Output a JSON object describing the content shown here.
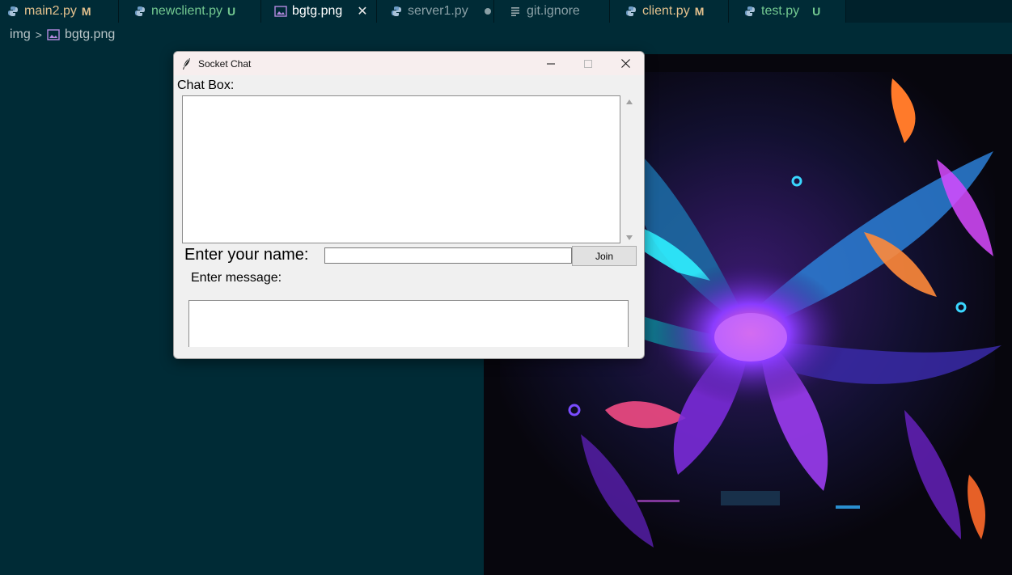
{
  "tabs": [
    {
      "name": "main2.py",
      "badge": "M",
      "icon": "python-icon",
      "color": "#e2c08d",
      "state": "modified"
    },
    {
      "name": "newclient.py",
      "badge": "U",
      "icon": "python-icon",
      "color": "#73c991",
      "state": "untracked"
    },
    {
      "name": "bgtg.png",
      "badge": "",
      "icon": "image-icon",
      "color": "#ffffff",
      "state": "active",
      "close": "✕"
    },
    {
      "name": "server1.py",
      "badge": "",
      "icon": "python-icon",
      "color": "#8aa0a6",
      "state": "unsaved"
    },
    {
      "name": "git.ignore",
      "badge": "",
      "icon": "lines-icon",
      "color": "#8aa0a6",
      "state": "normal"
    },
    {
      "name": "client.py",
      "badge": "M",
      "icon": "python-icon",
      "color": "#e2c08d",
      "state": "modified"
    },
    {
      "name": "test.py",
      "badge": "U",
      "icon": "python-icon",
      "color": "#73c991",
      "state": "untracked"
    }
  ],
  "breadcrumb": {
    "folder": "img",
    "separator": ">",
    "file": "bgtg.png"
  },
  "window": {
    "title": "Socket Chat",
    "chat_label": "Chat Box:",
    "name_label": "Enter your name:",
    "name_value": "",
    "join_label": "Join",
    "message_label": "Enter message:"
  },
  "colors": {
    "editor_bg": "#002b36",
    "tabbar_bg": "#00212b",
    "modified": "#e2c08d",
    "untracked": "#73c991"
  }
}
